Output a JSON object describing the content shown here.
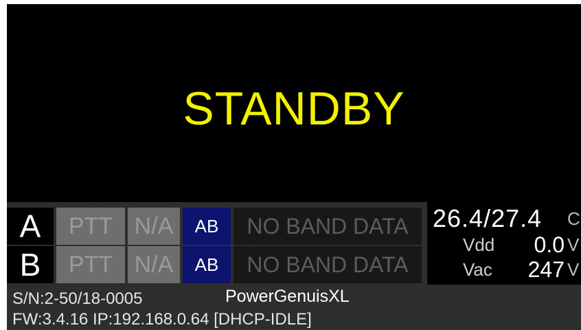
{
  "status": {
    "text": "STANDBY",
    "color": "#f2f200"
  },
  "radios": [
    {
      "letter": "A",
      "ptt": "PTT",
      "na": "N/A",
      "ab": "AB",
      "band": "NO BAND DATA"
    },
    {
      "letter": "B",
      "ptt": "PTT",
      "na": "N/A",
      "ab": "AB",
      "band": "NO BAND DATA"
    }
  ],
  "readings": {
    "temperature": "26.4/27.4",
    "temperature_unit": "C",
    "vdd_label": "Vdd",
    "vdd_value": "0.0",
    "vdd_unit": "V",
    "vac_label": "Vac",
    "vac_value": "247",
    "vac_unit": "V"
  },
  "info": {
    "serial": "S/N:2-50/18-0005",
    "model": "PowerGenuisXL",
    "firmware": "FW:3.4.16  IP:192.168.0.64 [DHCP-IDLE]"
  },
  "colors": {
    "background": "#000000",
    "ptt_inactive": "#6e6e6e",
    "ab_selected": "#0c1470",
    "band_cell": "#181818"
  }
}
